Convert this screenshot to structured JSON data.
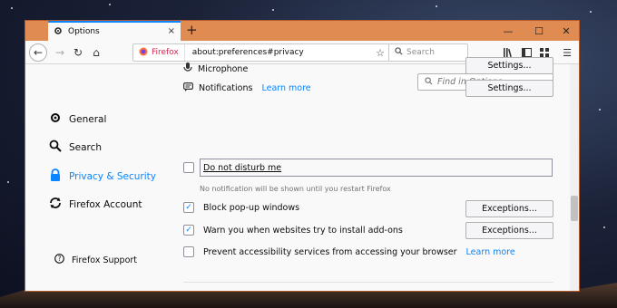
{
  "tab": {
    "title": "Options",
    "new_tab": "+",
    "close": "×"
  },
  "window_controls": {
    "minimize": "—",
    "maximize": "☐",
    "close": "✕"
  },
  "navbar": {
    "brand_label": "Firefox",
    "url": "about:preferences#privacy",
    "search_placeholder": "Search"
  },
  "find": {
    "placeholder": "Find in Options"
  },
  "sidebar": {
    "items": [
      {
        "label": "General",
        "icon": "gear-icon"
      },
      {
        "label": "Search",
        "icon": "search-icon"
      },
      {
        "label": "Privacy & Security",
        "icon": "lock-icon",
        "active": true
      },
      {
        "label": "Firefox Account",
        "icon": "sync-icon"
      }
    ],
    "support_label": "Firefox Support"
  },
  "main": {
    "microphone_label": "Microphone",
    "microphone_settings": "Settings...",
    "notifications_label": "Notifications",
    "notifications_learn_more": "Learn more",
    "notifications_settings": "Settings...",
    "dnd_label": "Do not disturb me",
    "dnd_hint": "No notification will be shown until you restart Firefox",
    "popup_label": "Block pop-up windows",
    "popup_checked": true,
    "popup_exceptions": "Exceptions...",
    "addons_label": "Warn you when websites try to install add-ons",
    "addons_checked": true,
    "addons_exceptions": "Exceptions...",
    "a11y_label": "Prevent accessibility services from accessing your browser",
    "a11y_learn_more": "Learn more"
  },
  "colors": {
    "accent": "#0a84ff",
    "titlebar": "#e08b52"
  }
}
